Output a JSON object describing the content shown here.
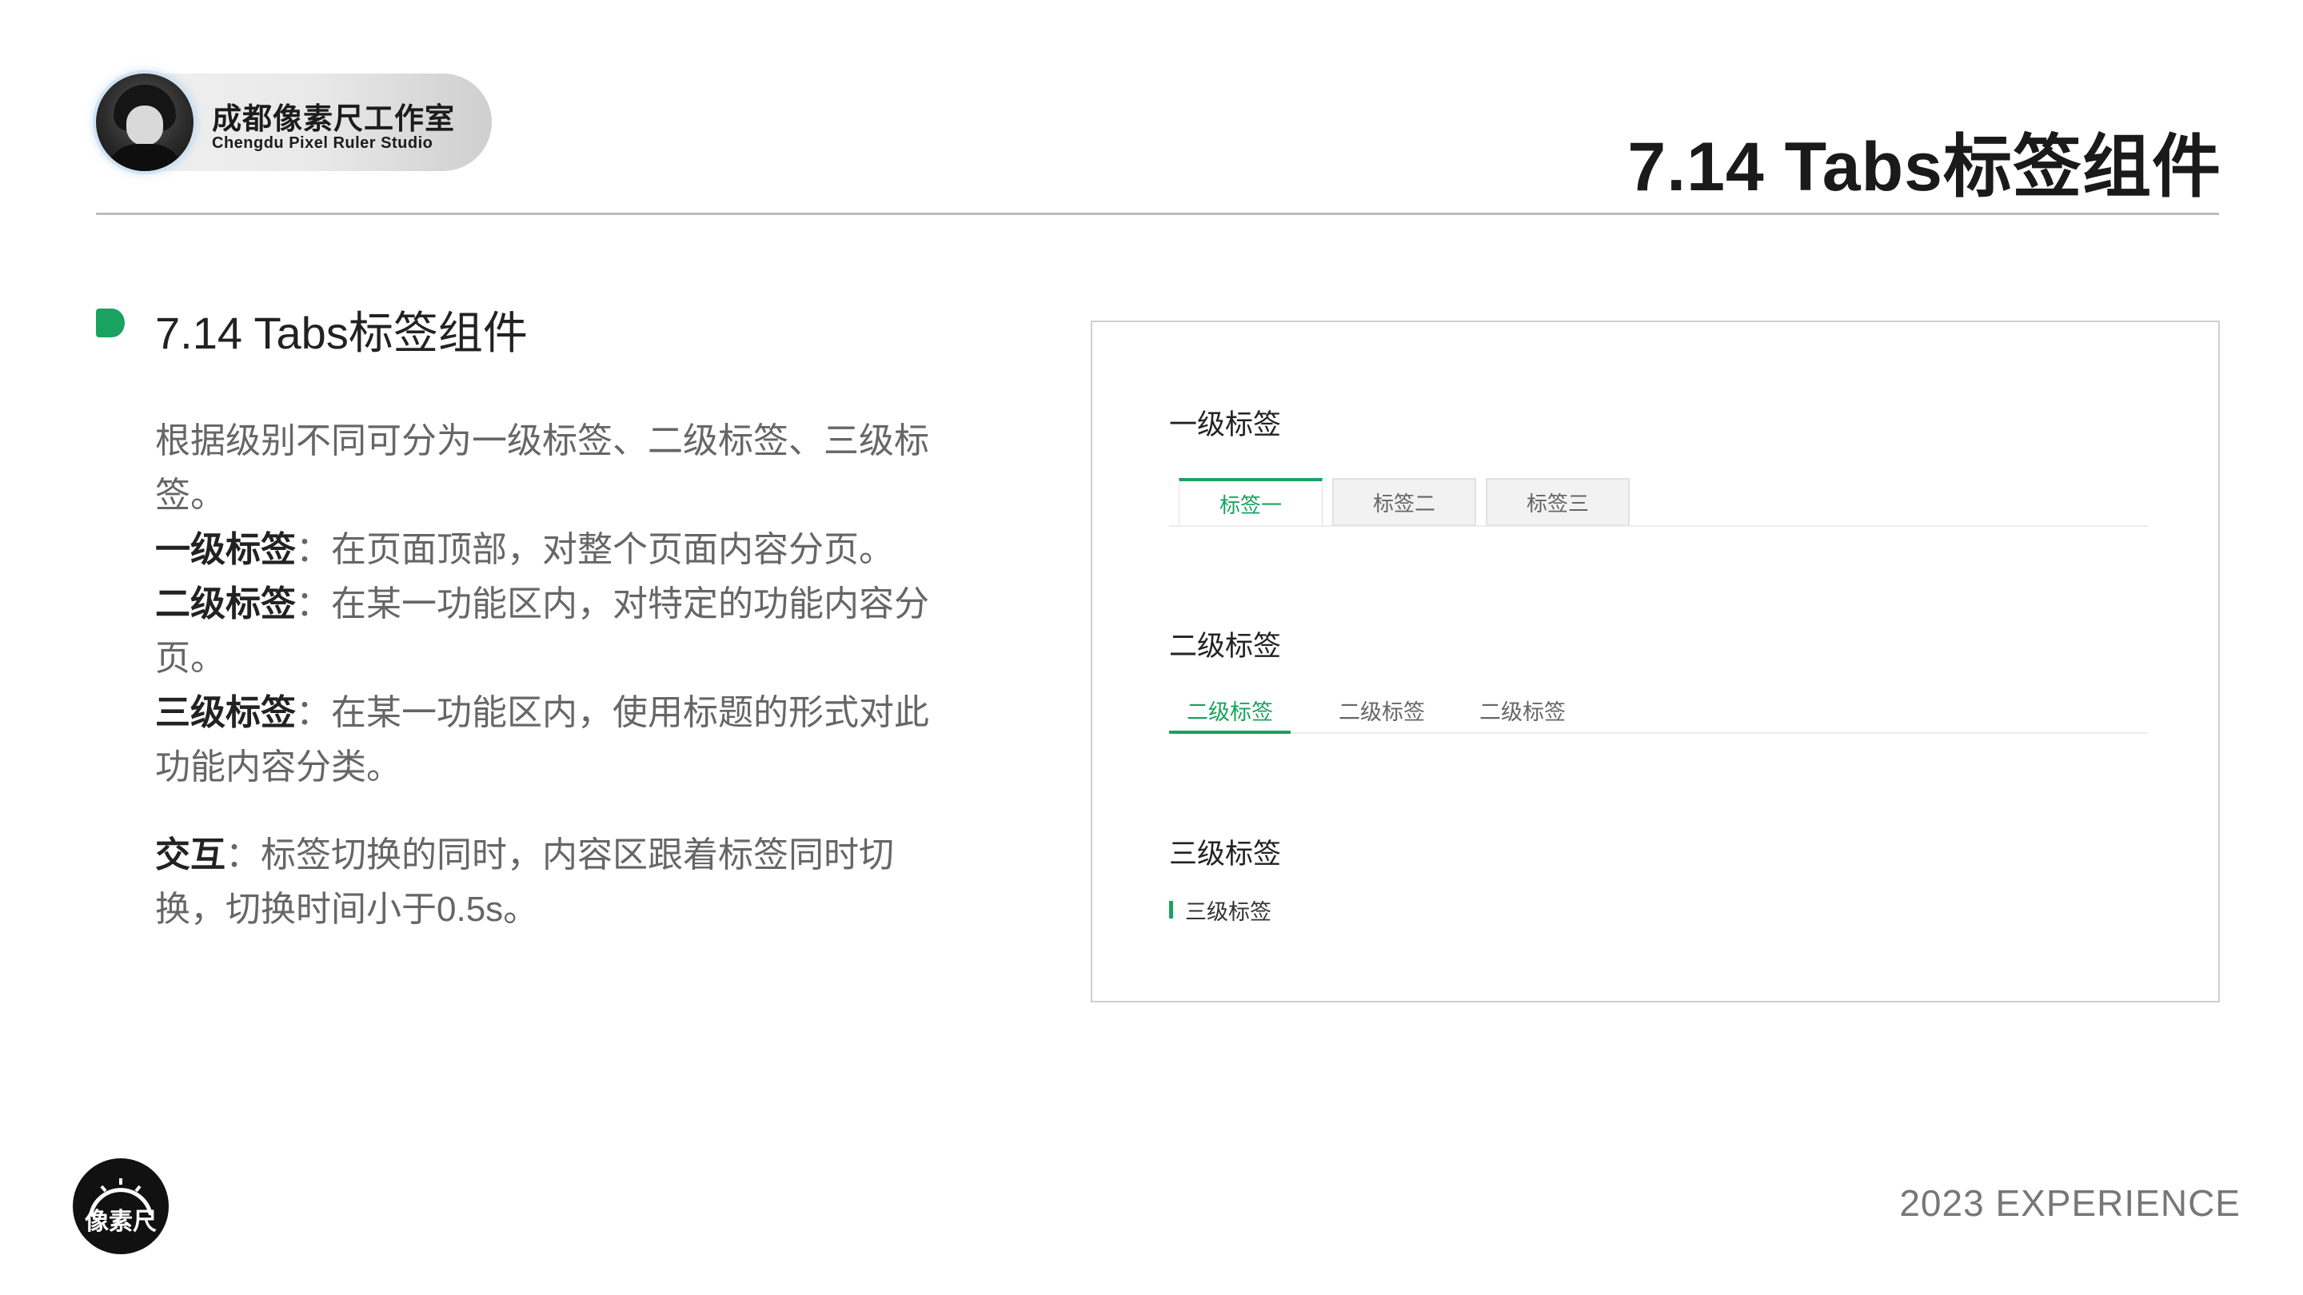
{
  "header": {
    "brand_name": "成都像素尺工作室",
    "brand_sub": "Chengdu Pixel Ruler Studio",
    "page_title": "7.14 Tabs标签组件"
  },
  "section": {
    "title": "7.14 Tabs标签组件"
  },
  "description": {
    "intro": "根据级别不同可分为一级标签、二级标签、三级标签。",
    "level1_label": "一级标签",
    "level1_text": "：在页面顶部，对整个页面内容分页。",
    "level2_label": "二级标签",
    "level2_text": "：在某一功能区内，对特定的功能内容分页。",
    "level3_label": "三级标签",
    "level3_text": "：在某一功能区内，使用标题的形式对此功能内容分类。",
    "interaction_label": "交互",
    "interaction_text": "：标签切换的同时，内容区跟着标签同时切换，切换时间小于0.5s。"
  },
  "panel": {
    "level1": {
      "heading": "一级标签",
      "tabs": [
        "标签一",
        "标签二",
        "标签三"
      ],
      "active_index": 0
    },
    "level2": {
      "heading": "二级标签",
      "tabs": [
        "二级标签",
        "二级标签",
        "二级标签"
      ],
      "active_index": 0
    },
    "level3": {
      "heading": "三级标签",
      "item": "三级标签"
    }
  },
  "footer": {
    "logo_text": "像素尺",
    "experience": "2023  EXPERIENCE"
  },
  "colors": {
    "accent": "#1aa260",
    "title": "#1a1a1a",
    "body_text": "#666666"
  }
}
